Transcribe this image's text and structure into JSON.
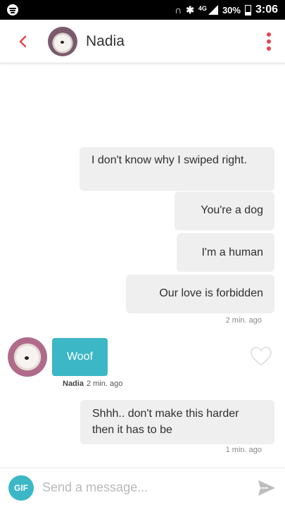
{
  "status_bar": {
    "network": "4G",
    "battery": "30%",
    "time": "3:06"
  },
  "header": {
    "contact_name": "Nadia"
  },
  "messages": [
    {
      "side": "sent",
      "text": "I don't know why I swiped right."
    },
    {
      "side": "sent",
      "text": "You're a dog"
    },
    {
      "side": "sent",
      "text": "I'm a human"
    },
    {
      "side": "sent",
      "text": "Our love is forbidden",
      "timestamp": "2 min. ago"
    },
    {
      "side": "received",
      "sender": "Nadia",
      "text": "Woof",
      "timestamp": "2 min. ago"
    },
    {
      "side": "sent",
      "text": "Shhh.. don't make this harder then it has to be",
      "timestamp": "1 min. ago"
    }
  ],
  "composer": {
    "gif_label": "GIF",
    "placeholder": "Send a message..."
  },
  "colors": {
    "accent": "#e8434c",
    "received_bubble": "#3cb7c6",
    "sent_bubble": "#efefef"
  }
}
